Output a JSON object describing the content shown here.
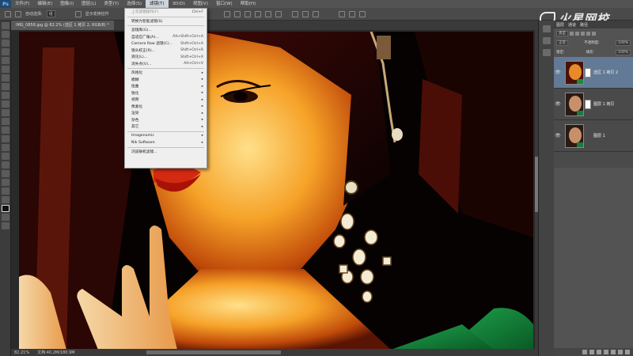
{
  "menubar": {
    "logo": "Ps",
    "items": [
      "文件(F)",
      "编辑(E)",
      "图像(I)",
      "图层(L)",
      "类型(Y)",
      "选择(S)",
      "滤镜(T)",
      "3D(D)",
      "视图(V)",
      "窗口(W)",
      "帮助(H)"
    ],
    "active_index": 6
  },
  "options_bar": {
    "auto_select_label": "自动选择:",
    "auto_select_value": "组",
    "show_transform_label": "显示变换控件"
  },
  "watermark": {
    "text": "火星网校"
  },
  "document": {
    "tab_title": "IMG_0858.jpg @ 82.2% (选区 1 拷贝 2, RGB/8) *",
    "zoom": "82.21%",
    "doc_info": "文档:40.2M/180.9M"
  },
  "filter_menu": {
    "items": [
      {
        "label": "上次滤镜操作(F)",
        "shortcut": "Ctrl+F",
        "dim": true
      },
      {
        "sep": true
      },
      {
        "label": "转换为智能滤镜(S)",
        "shortcut": ""
      },
      {
        "sep": true
      },
      {
        "label": "滤镜库(G)...",
        "shortcut": ""
      },
      {
        "label": "自适应广角(A)...",
        "shortcut": "Alt+Shift+Ctrl+A"
      },
      {
        "label": "Camera Raw 滤镜(C)...",
        "shortcut": "Shift+Ctrl+A"
      },
      {
        "label": "镜头校正(R)...",
        "shortcut": "Shift+Ctrl+R"
      },
      {
        "label": "液化(L)...",
        "shortcut": "Shift+Ctrl+X"
      },
      {
        "label": "消失点(V)...",
        "shortcut": "Alt+Ctrl+V"
      },
      {
        "sep": true
      },
      {
        "label": "风格化",
        "arrow": true
      },
      {
        "label": "模糊",
        "arrow": true
      },
      {
        "label": "扭曲",
        "arrow": true
      },
      {
        "label": "锐化",
        "arrow": true
      },
      {
        "label": "视频",
        "arrow": true
      },
      {
        "label": "像素化",
        "arrow": true
      },
      {
        "label": "渲染",
        "arrow": true
      },
      {
        "label": "杂色",
        "arrow": true
      },
      {
        "label": "其它",
        "arrow": true
      },
      {
        "sep": true
      },
      {
        "label": "Imagenomic",
        "arrow": true
      },
      {
        "label": "Nik Software",
        "arrow": true
      },
      {
        "sep": true
      },
      {
        "label": "浏览联机滤镜...",
        "shortcut": ""
      }
    ]
  },
  "layers_panel": {
    "tabs": [
      "图层",
      "通道",
      "路径"
    ],
    "filter_label": "类型",
    "blend_mode": "正常",
    "opacity_label": "不透明度:",
    "opacity_value": "100%",
    "lock_label": "锁定:",
    "fill_label": "填充:",
    "fill_value": "100%",
    "layers": [
      {
        "name": "选区 1 拷贝 2",
        "selected": true
      },
      {
        "name": "图层 1 拷贝",
        "selected": false
      },
      {
        "name": "图层 1",
        "selected": false
      }
    ]
  },
  "colors": {
    "accent_selected_layer": "#627a96",
    "menu_bg": "#efefef",
    "app_bg": "#282828"
  }
}
